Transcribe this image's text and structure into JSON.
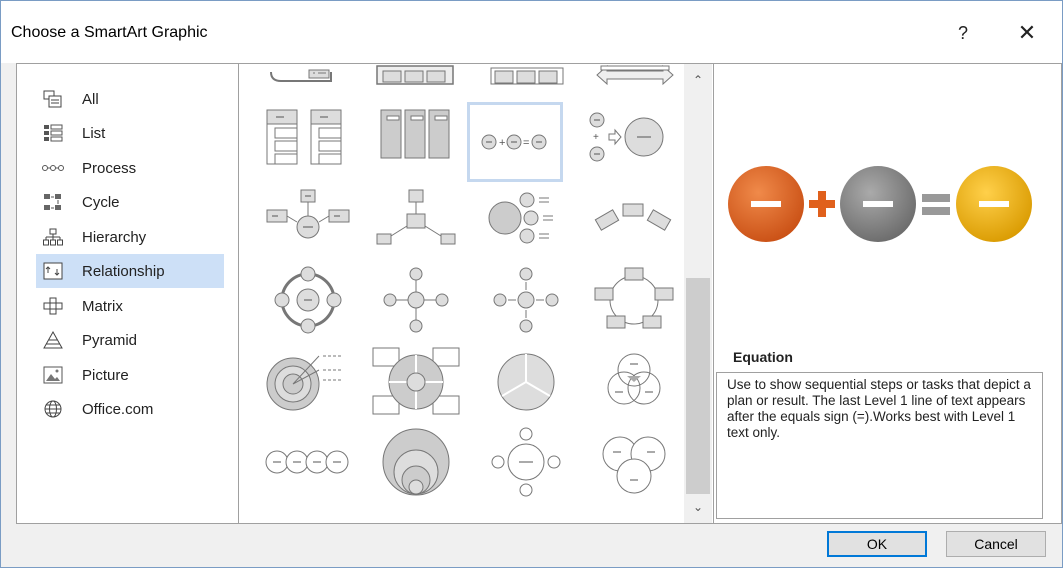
{
  "dialog": {
    "title": "Choose a SmartArt Graphic",
    "help_label": "?",
    "close_label": "✕"
  },
  "categories": [
    {
      "label": "All",
      "icon": "all-icon"
    },
    {
      "label": "List",
      "icon": "list-icon"
    },
    {
      "label": "Process",
      "icon": "process-icon"
    },
    {
      "label": "Cycle",
      "icon": "cycle-icon"
    },
    {
      "label": "Hierarchy",
      "icon": "hierarchy-icon"
    },
    {
      "label": "Relationship",
      "icon": "relationship-icon",
      "selected": true
    },
    {
      "label": "Matrix",
      "icon": "matrix-icon"
    },
    {
      "label": "Pyramid",
      "icon": "pyramid-icon"
    },
    {
      "label": "Picture",
      "icon": "picture-icon"
    },
    {
      "label": "Office.com",
      "icon": "globe-icon"
    }
  ],
  "gallery": {
    "selected_layout": "equation",
    "scroll_up": "⌃",
    "scroll_down": "⌄"
  },
  "preview": {
    "title": "Equation",
    "description": "Use to show sequential steps or tasks that depict a plan or result. The last Level 1 line of text appears after the equals sign (=).Works best with Level 1 text only.",
    "colors": {
      "orange": "#e0601c",
      "gray": "#808080",
      "yellow": "#f0b400"
    }
  },
  "buttons": {
    "ok": "OK",
    "cancel": "Cancel"
  }
}
